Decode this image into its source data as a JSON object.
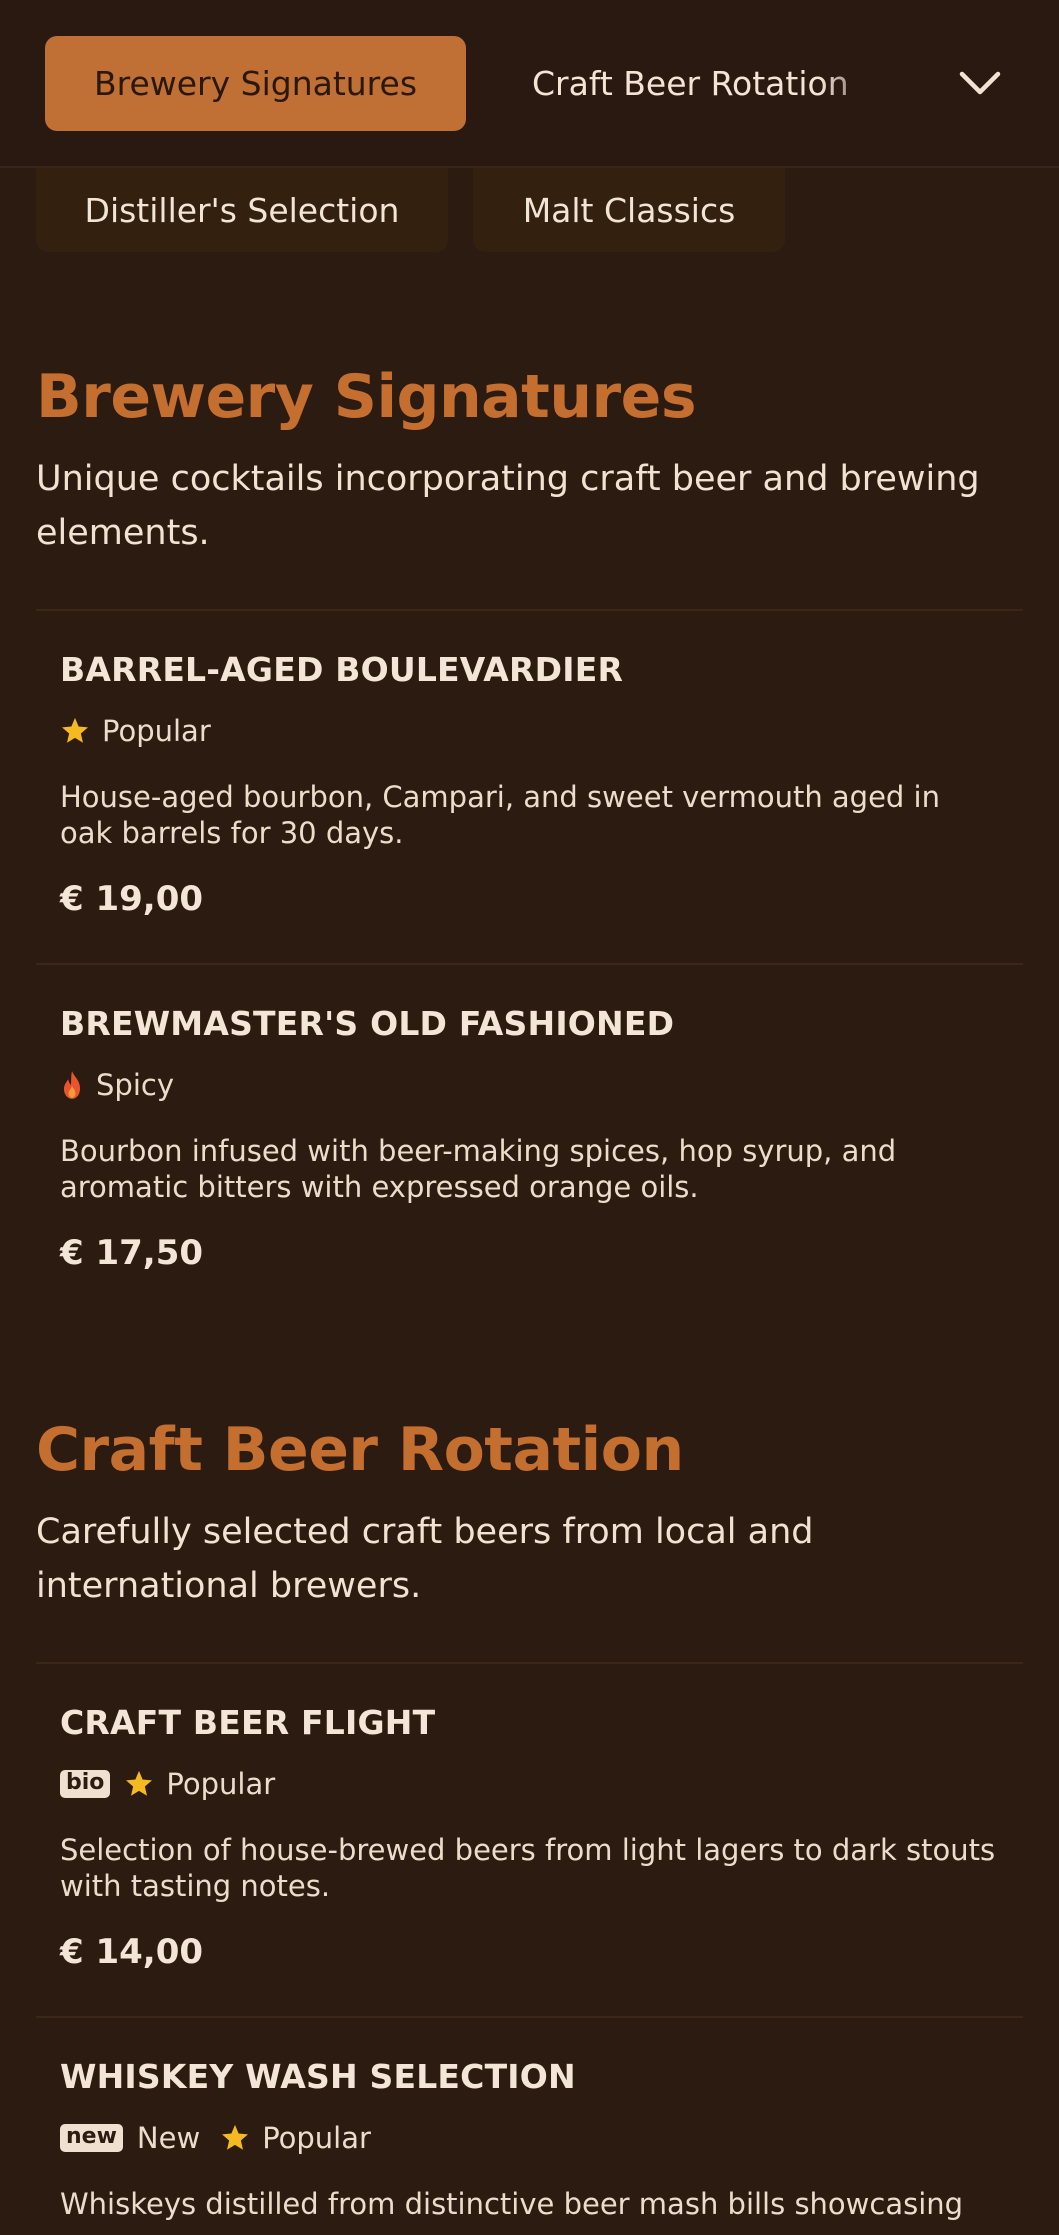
{
  "nav": {
    "tabs": [
      {
        "label": "Brewery Signatures",
        "active": true
      },
      {
        "label": "Craft Beer Rotation",
        "active": false
      },
      {
        "label": "Distiller's Selection",
        "active": false
      },
      {
        "label": "Malt Classics",
        "active": false
      }
    ],
    "expand_icon": "chevron-down-icon"
  },
  "sections": [
    {
      "title": "Brewery Signatures",
      "description": "Unique cocktails incorporating craft beer and brewing elements.",
      "items": [
        {
          "name": "BARREL-AGED BOULEVARDIER",
          "tags": [
            {
              "icon": "star-icon",
              "label": "Popular"
            }
          ],
          "description": "House-aged bourbon, Campari, and sweet vermouth aged in oak barrels for 30 days.",
          "price": "€ 19,00"
        },
        {
          "name": "BREWMASTER'S OLD FASHIONED",
          "tags": [
            {
              "icon": "flame-icon",
              "label": "Spicy"
            }
          ],
          "description": "Bourbon infused with beer-making spices, hop syrup, and aromatic bitters with expressed orange oils.",
          "price": "€ 17,50"
        }
      ]
    },
    {
      "title": "Craft Beer Rotation",
      "description": "Carefully selected craft beers from local and international brewers.",
      "items": [
        {
          "name": "CRAFT BEER FLIGHT",
          "badges": [
            "bio"
          ],
          "tags": [
            {
              "icon": "star-icon",
              "label": "Popular"
            }
          ],
          "description": "Selection of house-brewed beers from light lagers to dark stouts with tasting notes.",
          "price": "€ 14,00"
        },
        {
          "name": "WHISKEY WASH SELECTION",
          "badges": [
            "new"
          ],
          "tags": [
            {
              "icon": "none",
              "label": "New"
            },
            {
              "icon": "star-icon",
              "label": "Popular"
            }
          ],
          "description": "Whiskeys distilled from distinctive beer mash bills showcasing"
        }
      ]
    }
  ],
  "colors": {
    "background": "#2c1b11",
    "accent": "#c46e30",
    "active_pill": "#c06f35",
    "star": "#f5b921",
    "flame": "#e8542c"
  }
}
